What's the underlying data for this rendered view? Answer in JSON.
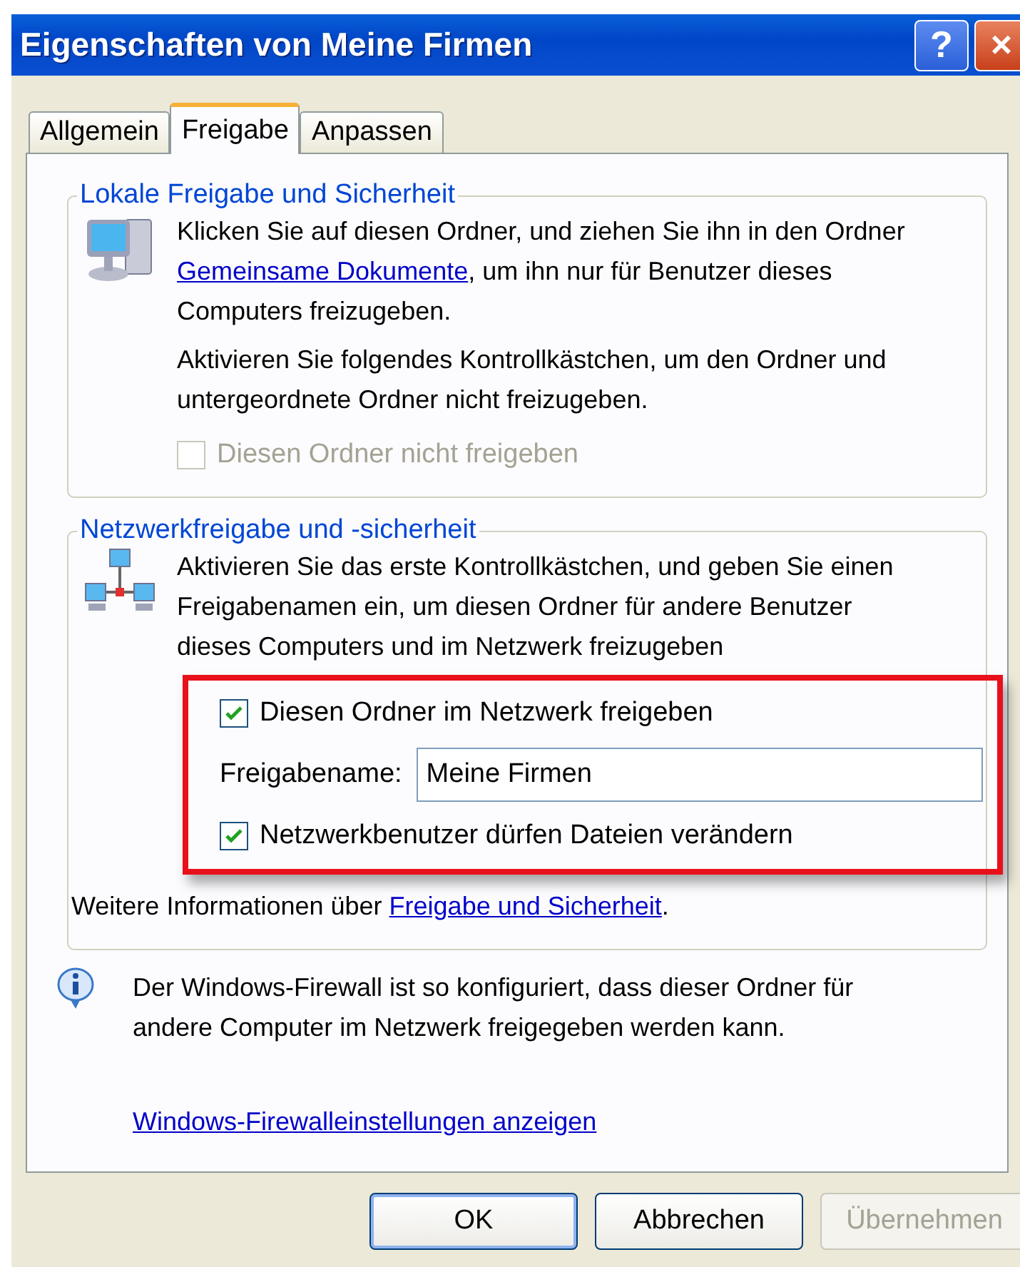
{
  "window": {
    "title": "Eigenschaften von Meine Firmen",
    "buttons": [
      "?",
      "×"
    ]
  },
  "tabs": [
    {
      "label": "Allgemein",
      "selected": false
    },
    {
      "label": "Freigabe",
      "selected": true
    },
    {
      "label": "Anpassen",
      "selected": false
    }
  ],
  "local_group": {
    "title": "Lokale Freigabe und Sicherheit",
    "intro": {
      "before": "Klicken Sie auf diesen Ordner, und ziehen Sie ihn in den Ordner ",
      "link": "Gemeinsame Dokumente",
      "after": ", um ihn nur für Benutzer dieses Computers freizugeben."
    },
    "note": "Aktivieren Sie folgendes Kontrollkästchen, um den Ordner und untergeordnete Ordner nicht freizugeben.",
    "checkbox": {
      "label": "Diesen Ordner nicht freigeben",
      "checked": false,
      "disabled": true
    }
  },
  "network_group": {
    "title": "Netzwerkfreigabe und -sicherheit",
    "intro": "Aktivieren Sie das erste Kontrollkästchen, und geben Sie einen Freigabenamen ein, um diesen Ordner für andere Benutzer dieses Computers und im Netzwerk freizugeben",
    "share_checkbox": {
      "label": "Diesen Ordner im Netzwerk freigeben",
      "checked": true,
      "disabled": false
    },
    "share_name": {
      "label": "Freigabename:",
      "value": "Meine Firmen"
    },
    "modify_checkbox": {
      "label": "Netzwerkbenutzer dürfen Dateien verändern",
      "checked": true,
      "disabled": false
    },
    "more_info": {
      "before": "Weitere Informationen über ",
      "link": "Freigabe und Sicherheit",
      "after": "."
    }
  },
  "firewall": {
    "text": "Der Windows-Firewall ist so konfiguriert, dass dieser Ordner für andere Computer im Netzwerk freigegeben werden kann.",
    "link": "Windows-Firewalleinstellungen anzeigen"
  },
  "buttons": [
    {
      "label": "OK",
      "disabled": false,
      "default": true
    },
    {
      "label": "Abbrechen",
      "disabled": false,
      "default": false
    },
    {
      "label": "Übernehmen",
      "disabled": true,
      "default": false
    }
  ]
}
